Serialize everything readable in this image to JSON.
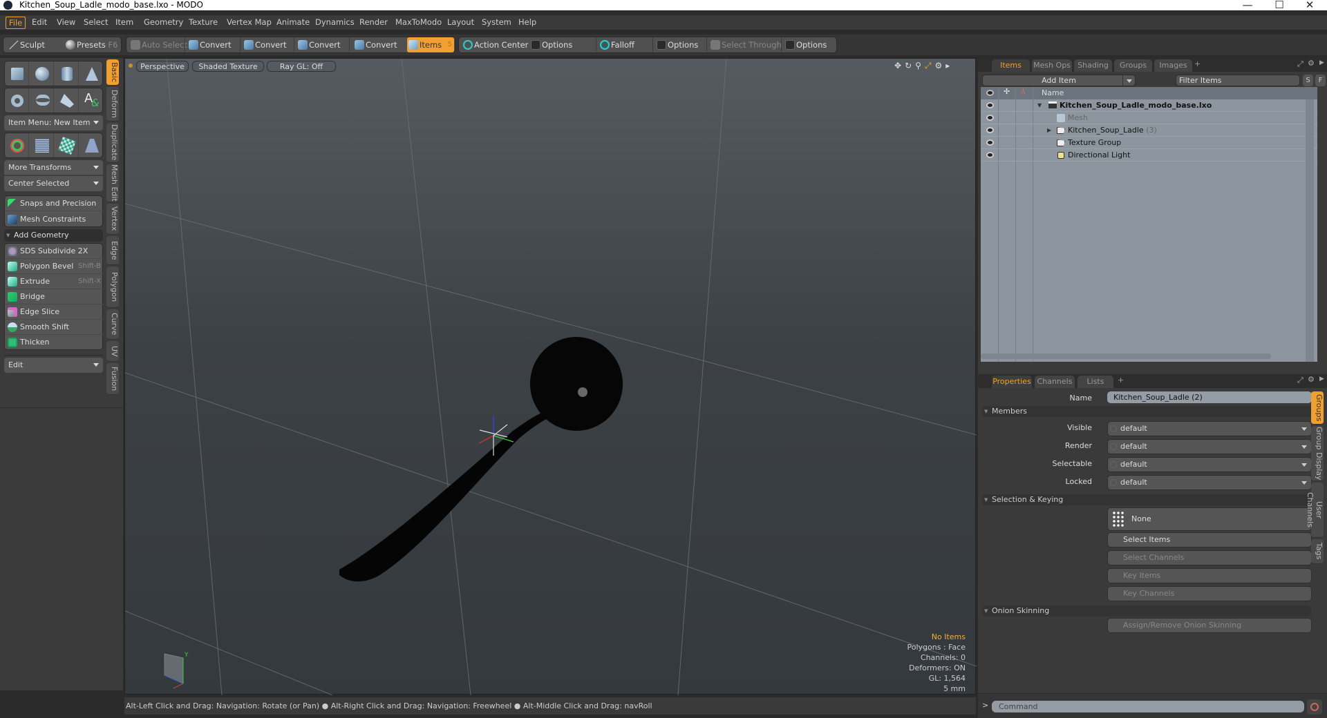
{
  "window": {
    "title": "Kitchen_Soup_Ladle_modo_base.lxo - MODO",
    "minimize": "—",
    "maximize": "☐",
    "close": "✕"
  },
  "menu": [
    "File",
    "Edit",
    "View",
    "Select",
    "Item",
    "Geometry",
    "Texture",
    "Vertex Map",
    "Animate",
    "Dynamics",
    "Render",
    "MaxToModo",
    "Layout",
    "System",
    "Help"
  ],
  "toolbar": {
    "sculpt": "Sculpt",
    "presets": "Presets",
    "presets_key": "F6",
    "auto_select": "Auto Select",
    "convert": "Convert",
    "items": "Items",
    "items_key": "5",
    "action_center": "Action Center",
    "options": "Options",
    "falloff": "Falloff",
    "select_through": "Select Through"
  },
  "left": {
    "item_menu": "Item Menu: New Item",
    "more_transforms": "More Transforms",
    "center_selected": "Center Selected",
    "snaps": "Snaps and Precision",
    "constraints": "Mesh Constraints",
    "add_geometry": "Add Geometry",
    "tools": [
      {
        "label": "SDS Subdivide 2X",
        "shortcut": ""
      },
      {
        "label": "Polygon Bevel",
        "shortcut": "Shift-B"
      },
      {
        "label": "Extrude",
        "shortcut": "Shift-X"
      },
      {
        "label": "Bridge",
        "shortcut": ""
      },
      {
        "label": "Edge Slice",
        "shortcut": ""
      },
      {
        "label": "Smooth Shift",
        "shortcut": ""
      },
      {
        "label": "Thicken",
        "shortcut": ""
      }
    ],
    "edit_dropdown": "Edit",
    "vtabs": [
      "Basic",
      "Deform",
      "Duplicate",
      "Mesh Edit",
      "Vertex",
      "Edge",
      "Polygon",
      "Curve",
      "UV",
      "Fusion"
    ]
  },
  "viewport": {
    "view": "Perspective",
    "shading": "Shaded Texture",
    "raygl": "Ray GL: Off",
    "hud": {
      "selection": "No Items",
      "polygons": "Polygons : Face",
      "channels": "Channels: 0",
      "deformers": "Deformers: ON",
      "gl": "GL: 1,564",
      "grid": "5 mm"
    }
  },
  "status": "Alt-Left Click and Drag: Navigation: Rotate (or Pan) ● Alt-Right Click and Drag: Navigation: Freewheel ● Alt-Middle Click and Drag: navRoll",
  "items_panel": {
    "tabs": [
      "Items",
      "Mesh Ops",
      "Shading",
      "Groups",
      "Images"
    ],
    "add_item": "Add Item",
    "filter_placeholder": "Filter Items",
    "s": "S",
    "f": "F",
    "col_name": "Name",
    "rows": [
      {
        "label": "Kitchen_Soup_Ladle_modo_base.lxo",
        "count": ""
      },
      {
        "label": "Mesh",
        "count": ""
      },
      {
        "label": "Kitchen_Soup_Ladle",
        "count": "(3)"
      },
      {
        "label": "Texture Group",
        "count": ""
      },
      {
        "label": "Directional Light",
        "count": ""
      }
    ]
  },
  "properties": {
    "tabs": [
      "Properties",
      "Channels",
      "Lists"
    ],
    "name_label": "Name",
    "name_value": "Kitchen_Soup_Ladle (2)",
    "members": "Members",
    "fields": [
      {
        "label": "Visible",
        "value": "default"
      },
      {
        "label": "Render",
        "value": "default"
      },
      {
        "label": "Selectable",
        "value": "default"
      },
      {
        "label": "Locked",
        "value": "default"
      }
    ],
    "sel_keying": "Selection & Keying",
    "none": "None",
    "select_items": "Select Items",
    "select_channels": "Select Channels",
    "key_items": "Key Items",
    "key_channels": "Key Channels",
    "onion": "Onion Skinning",
    "onion_btn": "Assign/Remove Onion Skinning",
    "vtabs": [
      "Groups",
      "Group Display",
      "User Channels",
      "Tags"
    ]
  },
  "command": {
    "prompt": ">",
    "placeholder": "Command"
  }
}
